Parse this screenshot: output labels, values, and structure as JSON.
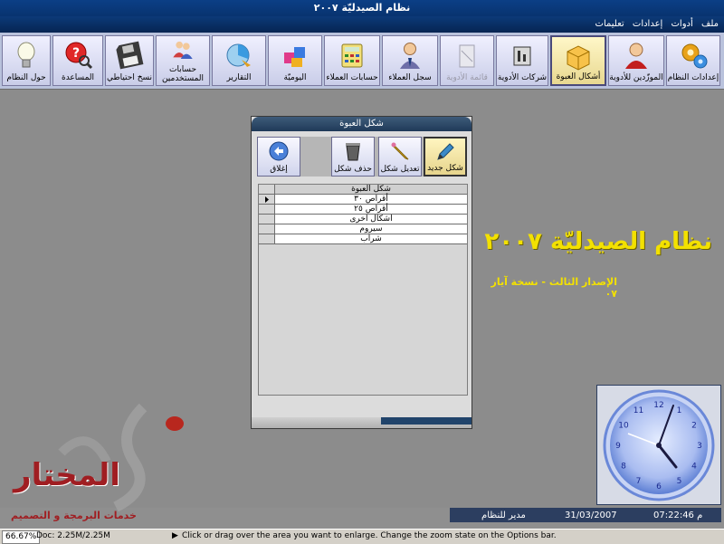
{
  "window": {
    "title": "نظام الصيدليّة ٢٠٠٧"
  },
  "menu": {
    "items": [
      "ملف",
      "أدوات",
      "إعدادات",
      "تعليمات"
    ]
  },
  "toolbar": {
    "buttons": [
      {
        "label": "إعدادات النظام",
        "icon": "gear-icon"
      },
      {
        "label": "الموزّدين للأدوية",
        "icon": "person-icon"
      },
      {
        "label": "أشكال العبوة",
        "icon": "box-icon"
      },
      {
        "label": "شركات الأدوية",
        "icon": "factory-icon"
      },
      {
        "label": "قائمة الأدوية",
        "icon": "medicine-icon"
      },
      {
        "label": "سجل العملاء",
        "icon": "customer-icon"
      },
      {
        "label": "حسابات العملاء",
        "icon": "calculator-icon"
      },
      {
        "label": "اليوميّة",
        "icon": "cubes-icon"
      },
      {
        "label": "التقارير",
        "icon": "report-icon"
      },
      {
        "label": "حسابات المستخدمين",
        "icon": "users-icon"
      },
      {
        "label": "نسخ احتياطي",
        "icon": "floppy-icon"
      },
      {
        "label": "المساعدة",
        "icon": "help-icon"
      },
      {
        "label": "حول النظام",
        "icon": "bulb-icon"
      }
    ]
  },
  "dialog": {
    "title": "شكل العبوة",
    "buttons": [
      {
        "label": "شكل جديد",
        "icon": "pen-icon"
      },
      {
        "label": "تعديل شكل",
        "icon": "pencil-icon"
      },
      {
        "label": "حذف شكل",
        "icon": "trash-icon"
      },
      {
        "label": "إغلاق",
        "icon": "back-icon"
      }
    ],
    "grid": {
      "header": "شكل العبوة",
      "rows": [
        "أقراص ٣٠",
        "أقراص ٢٥",
        "اشكال اخرى",
        "سيروم",
        "شراب"
      ]
    }
  },
  "banner": {
    "title": "نظام الصيدليّة ٢٠٠٧",
    "subtitle": "الإصدار الثالث - نسخة آيار ٠٧"
  },
  "clock": {
    "numbers": [
      "12",
      "1",
      "2",
      "3",
      "4",
      "5",
      "6",
      "7",
      "8",
      "9",
      "10",
      "11"
    ]
  },
  "status": {
    "user": "مدير للنظام",
    "date": "31/03/2007",
    "time": "م 07:22:46"
  },
  "bottom": {
    "zoom": "66.67%",
    "doc": "Doc: 2.25M/2.25M",
    "hint": "Click or drag over the area you want to enlarge. Change the zoom state on the Options bar."
  },
  "logo": {
    "name": "المختار",
    "tagline": "خدمات البرمجة و التصميم"
  },
  "colors": {
    "titlebar": "#0b3f86",
    "banner": "#f3e100",
    "status_dark": "#2c3e60",
    "logo": "#a01e22"
  }
}
